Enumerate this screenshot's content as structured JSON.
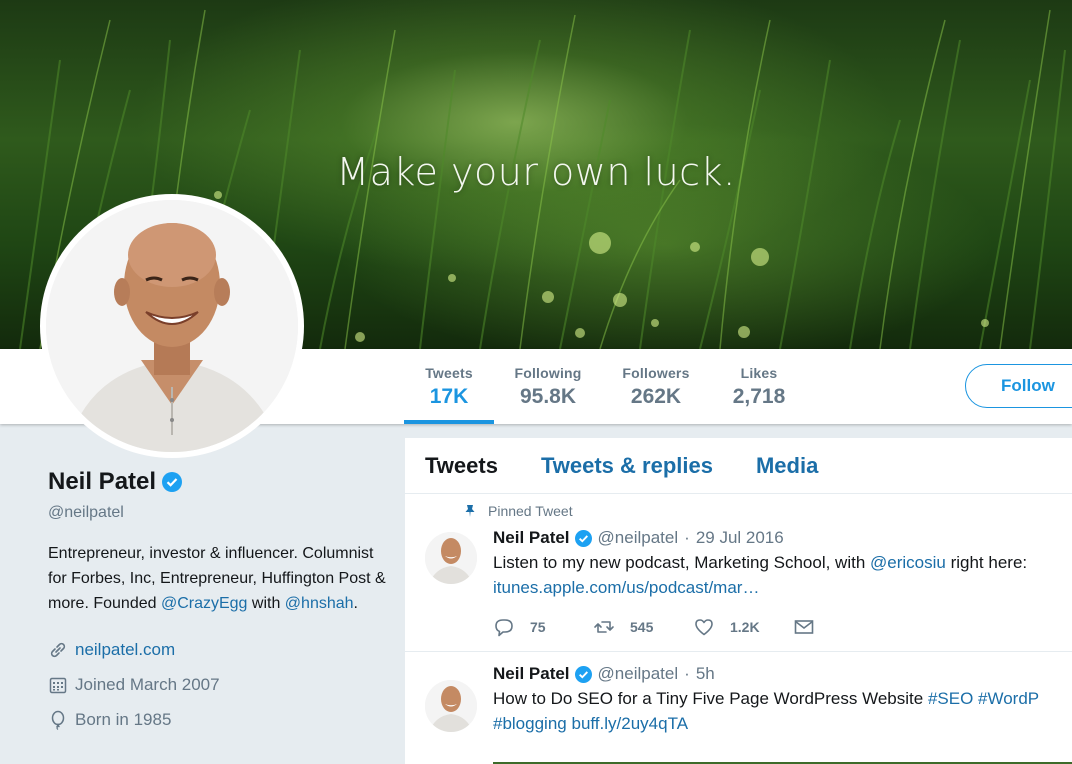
{
  "banner": {
    "tagline": "Make your own luck."
  },
  "stats": [
    {
      "label": "Tweets",
      "value": "17K"
    },
    {
      "label": "Following",
      "value": "95.8K"
    },
    {
      "label": "Followers",
      "value": "262K"
    },
    {
      "label": "Likes",
      "value": "2,718"
    }
  ],
  "follow_label": "Follow",
  "profile": {
    "name": "Neil Patel",
    "handle": "@neilpatel",
    "bio_text_1": "Entrepreneur, investor & influencer. Columnist for Forbes, Inc, Entrepreneur, Huffington Post & more. Founded ",
    "bio_mention_1": "@CrazyEgg",
    "bio_text_2": " with ",
    "bio_mention_2": "@hnshah",
    "bio_text_3": ".",
    "website": "neilpatel.com",
    "joined": "Joined March 2007",
    "born": "Born in 1985"
  },
  "timeline": {
    "tabs": [
      "Tweets",
      "Tweets & replies",
      "Media"
    ],
    "tweets": [
      {
        "pinned_label": "Pinned Tweet",
        "name": "Neil Patel",
        "handle": "@neilpatel",
        "date": "29 Jul 2016",
        "text_1": "Listen to my new podcast, Marketing School, with ",
        "mention": "@ericosiu",
        "text_2": " right here:",
        "link": "itunes.apple.com/us/podcast/mar…",
        "replies": "75",
        "retweets": "545",
        "likes": "1.2K"
      },
      {
        "name": "Neil Patel",
        "handle": "@neilpatel",
        "date": "5h",
        "text_1": "How to Do SEO for a Tiny Five Page WordPress Website ",
        "tag_1": "#SEO",
        "tag_2": "#WordP",
        "tag_3": "#blogging",
        "link": "buff.ly/2uy4qTA"
      }
    ]
  },
  "colors": {
    "accent": "#1b95e0",
    "link": "#1b6ea8",
    "muted": "#657786",
    "background": "#e6ecf0"
  }
}
